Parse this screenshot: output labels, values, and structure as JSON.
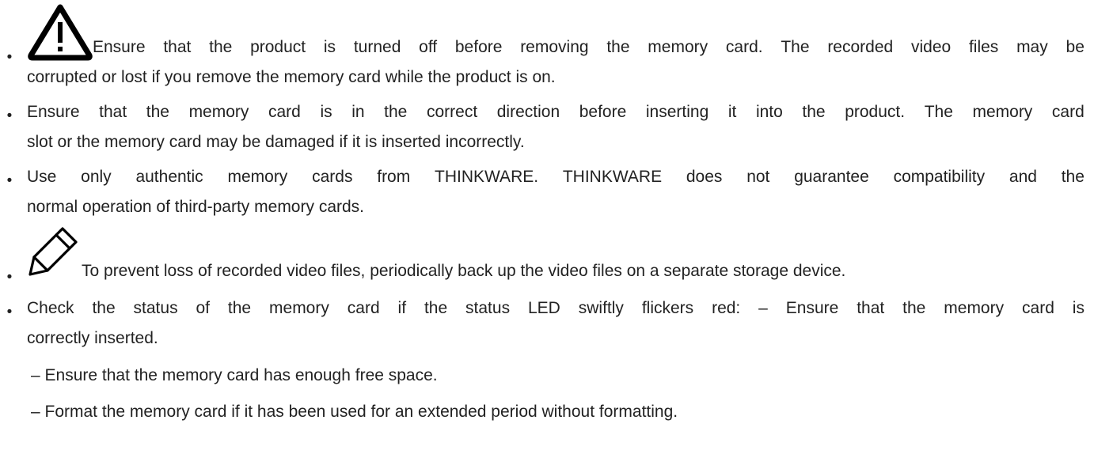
{
  "notes": [
    {
      "icon": "warning-icon",
      "words": [
        "Ensure",
        "that",
        "the",
        "product",
        "is",
        "turned",
        "off",
        "before",
        "removing",
        "the",
        "memory",
        "card.",
        "The",
        "recorded",
        "video",
        "files",
        "may",
        "be"
      ],
      "line2": "corrupted or lost if you remove the memory card while the product is on."
    },
    {
      "words": [
        "Ensure",
        "that",
        "the",
        "memory",
        "card",
        "is",
        "in",
        "the",
        "correct",
        "direction",
        "before",
        "inserting",
        "it",
        "into",
        "the",
        "product.",
        "The",
        "memory",
        "card"
      ],
      "line2": "slot or the memory card may be damaged if it is inserted incorrectly."
    },
    {
      "words": [
        "Use",
        "only",
        "authentic",
        "memory",
        "cards",
        "from",
        "THINKWARE.",
        "THINKWARE",
        "does",
        "not",
        "guarantee",
        "compatibility",
        "and",
        "the"
      ],
      "line2": "normal operation of third-party memory cards."
    },
    {
      "icon": "pencil-icon",
      "line1": "To prevent loss of recorded video files, periodically back up the video files on a separate storage device."
    },
    {
      "words": [
        "Check",
        "the",
        "status",
        "of",
        "the",
        "memory",
        "card",
        "if",
        "the",
        "status",
        "LED",
        "swiftly",
        "flickers",
        "red:",
        "–",
        "Ensure",
        "that",
        "the",
        "memory",
        "card",
        "is"
      ],
      "line2": "correctly inserted.",
      "sub_items": [
        "– Ensure that the memory card has enough free space.",
        "– Format the memory card if it has been used for an extended period without formatting."
      ]
    }
  ]
}
